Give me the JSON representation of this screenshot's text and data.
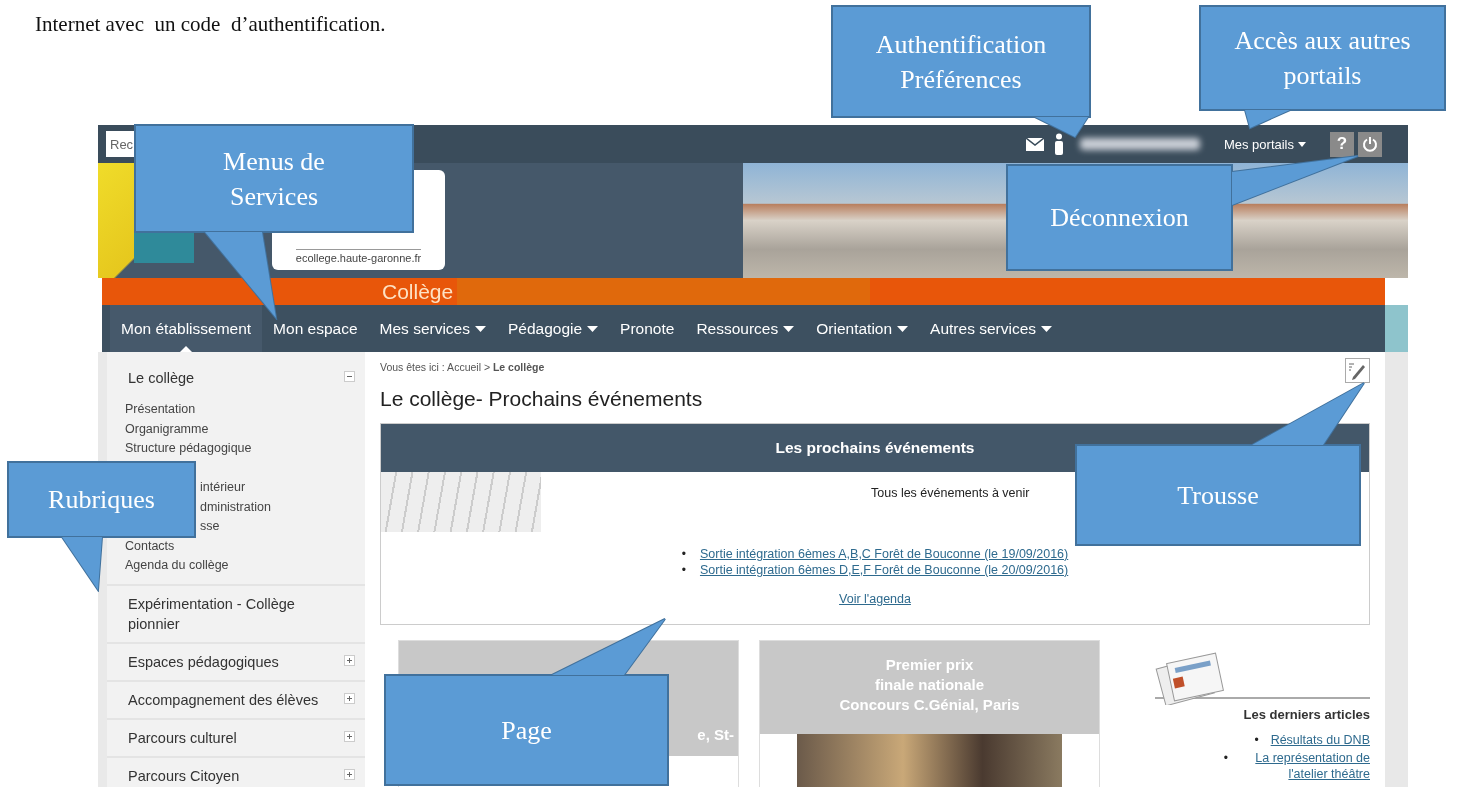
{
  "document_text": "Internet avec  un code  d’authentification.",
  "top_bar": {
    "search": {
      "placeholder": "Rec"
    },
    "portals_label": "Mes portails",
    "help_label": "?"
  },
  "banner": {
    "logo_url": "ecollege.haute-garonne.fr"
  },
  "school_bar": {
    "label": "Collège"
  },
  "nav": [
    {
      "label": "Mon établissement",
      "selected": true,
      "has_menu": false
    },
    {
      "label": "Mon espace",
      "selected": false,
      "has_menu": false
    },
    {
      "label": "Mes services",
      "selected": false,
      "has_menu": true
    },
    {
      "label": "Pédagogie",
      "selected": false,
      "has_menu": true
    },
    {
      "label": "Pronote",
      "selected": false,
      "has_menu": false
    },
    {
      "label": "Ressources",
      "selected": false,
      "has_menu": true
    },
    {
      "label": "Orientation",
      "selected": false,
      "has_menu": true
    },
    {
      "label": "Autres services",
      "selected": false,
      "has_menu": true
    }
  ],
  "sidebar": [
    {
      "label": "Le collège",
      "expanded": true,
      "children": [
        {
          "label": "Présentation",
          "kind": "link"
        },
        {
          "label": "Organigramme",
          "kind": "link"
        },
        {
          "label": "Structure pédagogique",
          "kind": "link"
        },
        {
          "label": "intérieur",
          "kind": "partial"
        },
        {
          "label": "dministration",
          "kind": "partial"
        },
        {
          "label": "sse",
          "kind": "partial"
        },
        {
          "label": "Contacts",
          "kind": "link"
        },
        {
          "label": "Agenda du collège",
          "kind": "link"
        }
      ]
    },
    {
      "label": "Expérimentation - Collège pionnier"
    },
    {
      "label": "Espaces pédagogiques",
      "expanded": false
    },
    {
      "label": "Accompagnement des élèves",
      "expanded": false
    },
    {
      "label": "Parcours culturel",
      "expanded": false
    },
    {
      "label": "Parcours Citoyen",
      "expanded": false
    }
  ],
  "breadcrumb": "Vous êtes ici : Accueil > **Le collège**",
  "page_title": "Le collège- Prochains événements",
  "events": {
    "title": "Les prochains événements",
    "subtitle": "Tous les événements à venir",
    "items": [
      {
        "bullet": "•",
        "text": "Sortie intégration 6èmes A,B,C Forêt de Bouconne (le 19/09/2016)"
      },
      {
        "bullet": "•",
        "text": "Sortie intégration 6èmes D,E,F Forêt de Bouconne (le 20/09/2016)"
      }
    ],
    "agenda_link": "Voir l'agenda"
  },
  "cards": [
    {
      "title": "e, St-",
      "kind": "partial"
    },
    {
      "title": "Premier prix\nfinale nationale\nConcours C.Génial, Paris",
      "kind": "full"
    }
  ],
  "articles": {
    "title": "Les derniers articles",
    "items": [
      {
        "bullet": "•",
        "text": "Résultats du DNB"
      },
      {
        "bullet": "•",
        "text": "La représentation de l'atelier théâtre"
      }
    ]
  },
  "callouts": [
    {
      "text": "Authentification Préférences"
    },
    {
      "text": "Accès aux autres portails"
    },
    {
      "text": "Menus de Services"
    },
    {
      "text": "Déconnexion"
    },
    {
      "text": "Rubriques"
    },
    {
      "text": "Trousse"
    },
    {
      "text": "Page"
    }
  ]
}
